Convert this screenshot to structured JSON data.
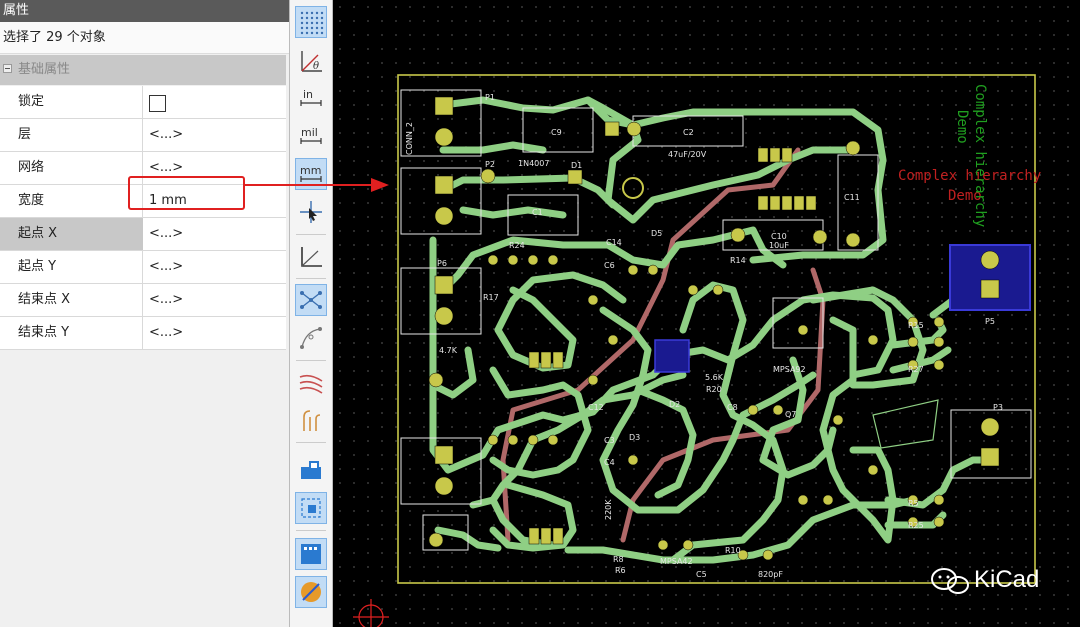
{
  "panel": {
    "title": "属性",
    "selection_count": "选择了 29 个对象",
    "group_label": "基础属性",
    "rows": [
      {
        "name": "锁定",
        "value": ""
      },
      {
        "name": "层",
        "value": "<...>"
      },
      {
        "name": "网络",
        "value": "<...>"
      },
      {
        "name": "宽度",
        "value": "1 mm"
      },
      {
        "name": "起点 X",
        "value": "<...>"
      },
      {
        "name": "起点 Y",
        "value": "<...>"
      },
      {
        "name": "结束点 X",
        "value": "<...>"
      },
      {
        "name": "结束点 Y",
        "value": "<...>"
      }
    ]
  },
  "toolbar": {
    "icons": [
      "grid-dots-icon",
      "polar-coords-icon",
      "inch-units-icon",
      "mil-units-icon",
      "mm-units-icon",
      "cursor-crosshair-icon",
      "axes-origin-icon",
      "ratsnest-icon",
      "curved-ratsnest-icon",
      "track-outline-icon",
      "via-outline-icon",
      "zone-fill-icon",
      "pad-fill-icon",
      "layer-manager-icon",
      "net-highlight-icon"
    ],
    "unit_inch": "in",
    "unit_mil": "mil",
    "unit_mm": "mm"
  },
  "board": {
    "texts": {
      "p1": "P1",
      "p2": "P2",
      "p3": "P3",
      "p5": "P5",
      "p6": "P6",
      "conn2": "CONN_2",
      "c9": "C9",
      "d1": "D1",
      "c2": "C2",
      "c1": "C1",
      "c10": "C10",
      "c11": "C11",
      "c14": "C14",
      "cap47": "47uF/20V",
      "cap10u": "10uF",
      "diode": "1N4007",
      "r14": "R14",
      "r15": "R15",
      "r27": "R27",
      "r5": "R5",
      "r25": "R25",
      "r10": "R10",
      "r8": "R8",
      "r6": "R6",
      "r20": "R20",
      "r24": "R24",
      "r17": "R17",
      "q7": "Q7",
      "d2": "D2",
      "d3": "D3",
      "d5": "D5",
      "d7": "D7",
      "c3": "C3",
      "c4": "C4",
      "c5": "C5",
      "c6": "C6",
      "c8": "C8",
      "c12": "C12",
      "mpsa42": "MPSA42",
      "mpsa92": "MPSA92",
      "v47k": "4.7K",
      "v56k": "5.6K",
      "v220k": "220K",
      "v820pf": "820pF",
      "complex_hier_red": "Complex hierarchy",
      "demo_red": "Demo",
      "complex_hier_green": "Complex hierarchy",
      "demo_green": "Demo"
    }
  },
  "brand": {
    "name": "KiCad"
  },
  "colors": {
    "track": "#8fcf84",
    "track_back": "#b06868",
    "board_edge": "#c8c84a",
    "pad": "#c8c84a",
    "silk": "#e6e6e6",
    "selection_red": "#e02020",
    "highlight_blue": "#3a3ad8"
  }
}
